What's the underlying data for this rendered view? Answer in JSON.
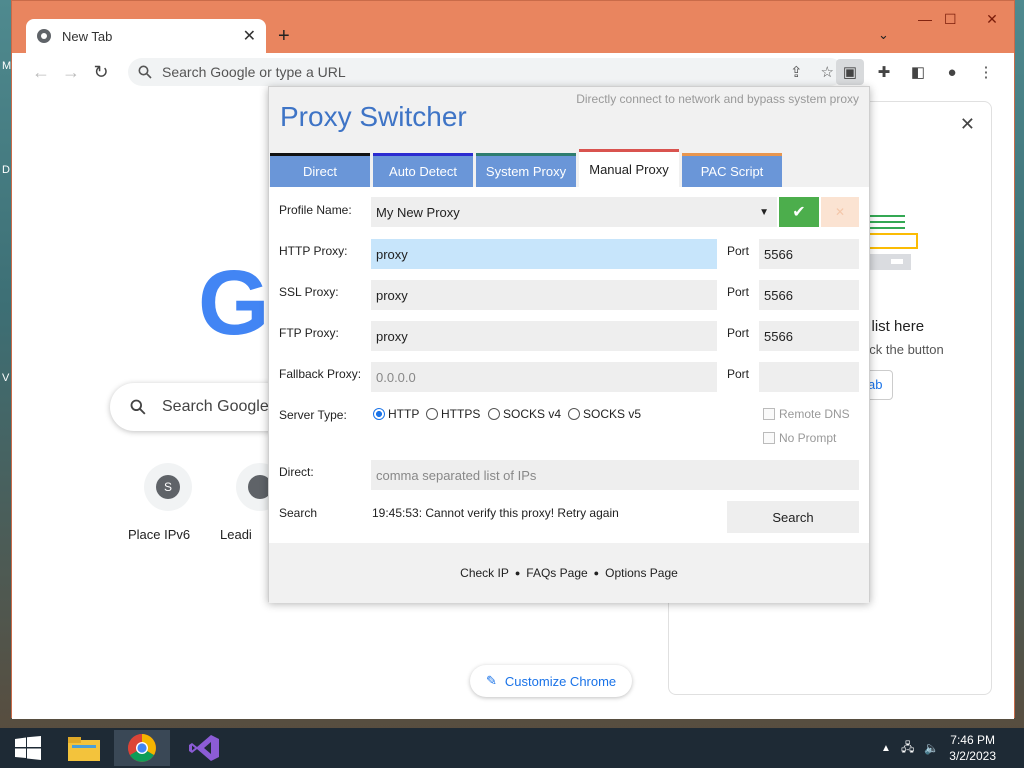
{
  "desktop": {
    "edge_letters": [
      "M",
      "D",
      "V"
    ]
  },
  "browser": {
    "tab": {
      "title": "New Tab"
    },
    "omnibox": {
      "placeholder": "Search Google or type a URL"
    },
    "ntp": {
      "logo_letter": "G",
      "search_placeholder": "Search Google",
      "shortcuts": [
        {
          "initial": "S",
          "label": "Place IPv6"
        },
        {
          "initial": "",
          "label": "Leadi"
        }
      ],
      "customize_label": "Customize Chrome"
    },
    "side_panel": {
      "title": "g list here",
      "subtitle": "click the button",
      "button": "ab"
    }
  },
  "proxy_switcher": {
    "title": "Proxy Switcher",
    "description": "Directly connect to network and bypass system proxy",
    "tabs": [
      {
        "label": "Direct",
        "active": false,
        "color": "#111111"
      },
      {
        "label": "Auto Detect",
        "active": false,
        "color": "#2b2bd0"
      },
      {
        "label": "System Proxy",
        "active": false,
        "color": "#2e7d6f"
      },
      {
        "label": "Manual Proxy",
        "active": true,
        "color": "#d9534f"
      },
      {
        "label": "PAC Script",
        "active": false,
        "color": "#e8964f"
      }
    ],
    "form": {
      "profile_label": "Profile Name:",
      "profile_value": "My New Proxy",
      "http_label": "HTTP Proxy:",
      "http_value": "proxy",
      "http_port": "5566",
      "ssl_label": "SSL Proxy:",
      "ssl_value": "proxy",
      "ssl_port": "5566",
      "ftp_label": "FTP Proxy:",
      "ftp_value": "proxy",
      "ftp_port": "5566",
      "fallback_label": "Fallback Proxy:",
      "fallback_placeholder": "0.0.0.0",
      "fallback_port": "",
      "port_label": "Port",
      "server_type_label": "Server Type:",
      "server_types": [
        "HTTP",
        "HTTPS",
        "SOCKS v4",
        "SOCKS v5"
      ],
      "server_type_selected": "HTTP",
      "remote_dns": "Remote DNS",
      "no_prompt": "No Prompt",
      "direct_label": "Direct:",
      "direct_placeholder": "comma separated list of IPs",
      "search_label": "Search",
      "status": "19:45:53: Cannot verify this proxy! Retry again",
      "search_button": "Search"
    },
    "footer": [
      "Check IP",
      "FAQs Page",
      "Options Page"
    ],
    "footer_sep": "●"
  },
  "taskbar": {
    "time": "7:46 PM",
    "date": "3/2/2023"
  }
}
